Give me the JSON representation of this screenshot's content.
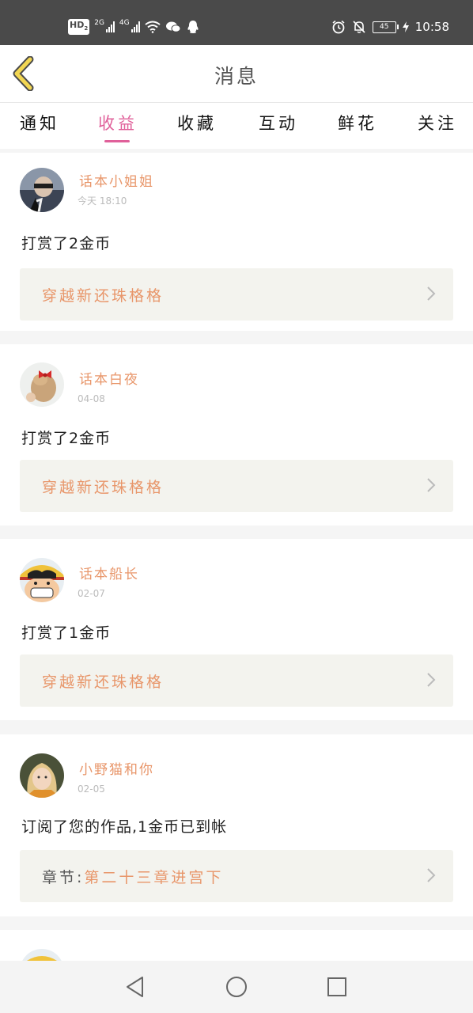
{
  "status_bar": {
    "hd_badge": "HD",
    "hd_sub": "2",
    "network_1": "2G",
    "network_2": "4G",
    "battery": "45",
    "time": "10:58",
    "icons": [
      "hd-icon",
      "signal-icon",
      "wifi-icon",
      "wechat-icon",
      "qq-icon",
      "alarm-icon",
      "mute-icon",
      "battery-icon",
      "charging-icon"
    ]
  },
  "header": {
    "title": "消息"
  },
  "tabs": [
    {
      "label": "通知"
    },
    {
      "label": "收益"
    },
    {
      "label": "收藏"
    },
    {
      "label": "互动"
    },
    {
      "label": "鲜花"
    },
    {
      "label": "关注"
    }
  ],
  "active_tab": "收益",
  "colors": {
    "accent": "#e0609a",
    "orange": "#e8966a",
    "work_bg": "#f3f3ee"
  },
  "messages": [
    {
      "name": "话本小姐姐",
      "date": "今天 18:10",
      "text": "打赏了2金币",
      "work": "穿越新还珠格格"
    },
    {
      "name": "话本白夜",
      "date": "04-08",
      "text": "打赏了2金币",
      "work": "穿越新还珠格格"
    },
    {
      "name": "话本船长",
      "date": "02-07",
      "text": "打赏了1金币",
      "work": "穿越新还珠格格"
    },
    {
      "name": "小野猫和你",
      "date": "02-05",
      "text": "订阅了您的作品,1金币已到帐",
      "work_prefix": "章节:",
      "work": "第二十三章进宫下"
    }
  ]
}
